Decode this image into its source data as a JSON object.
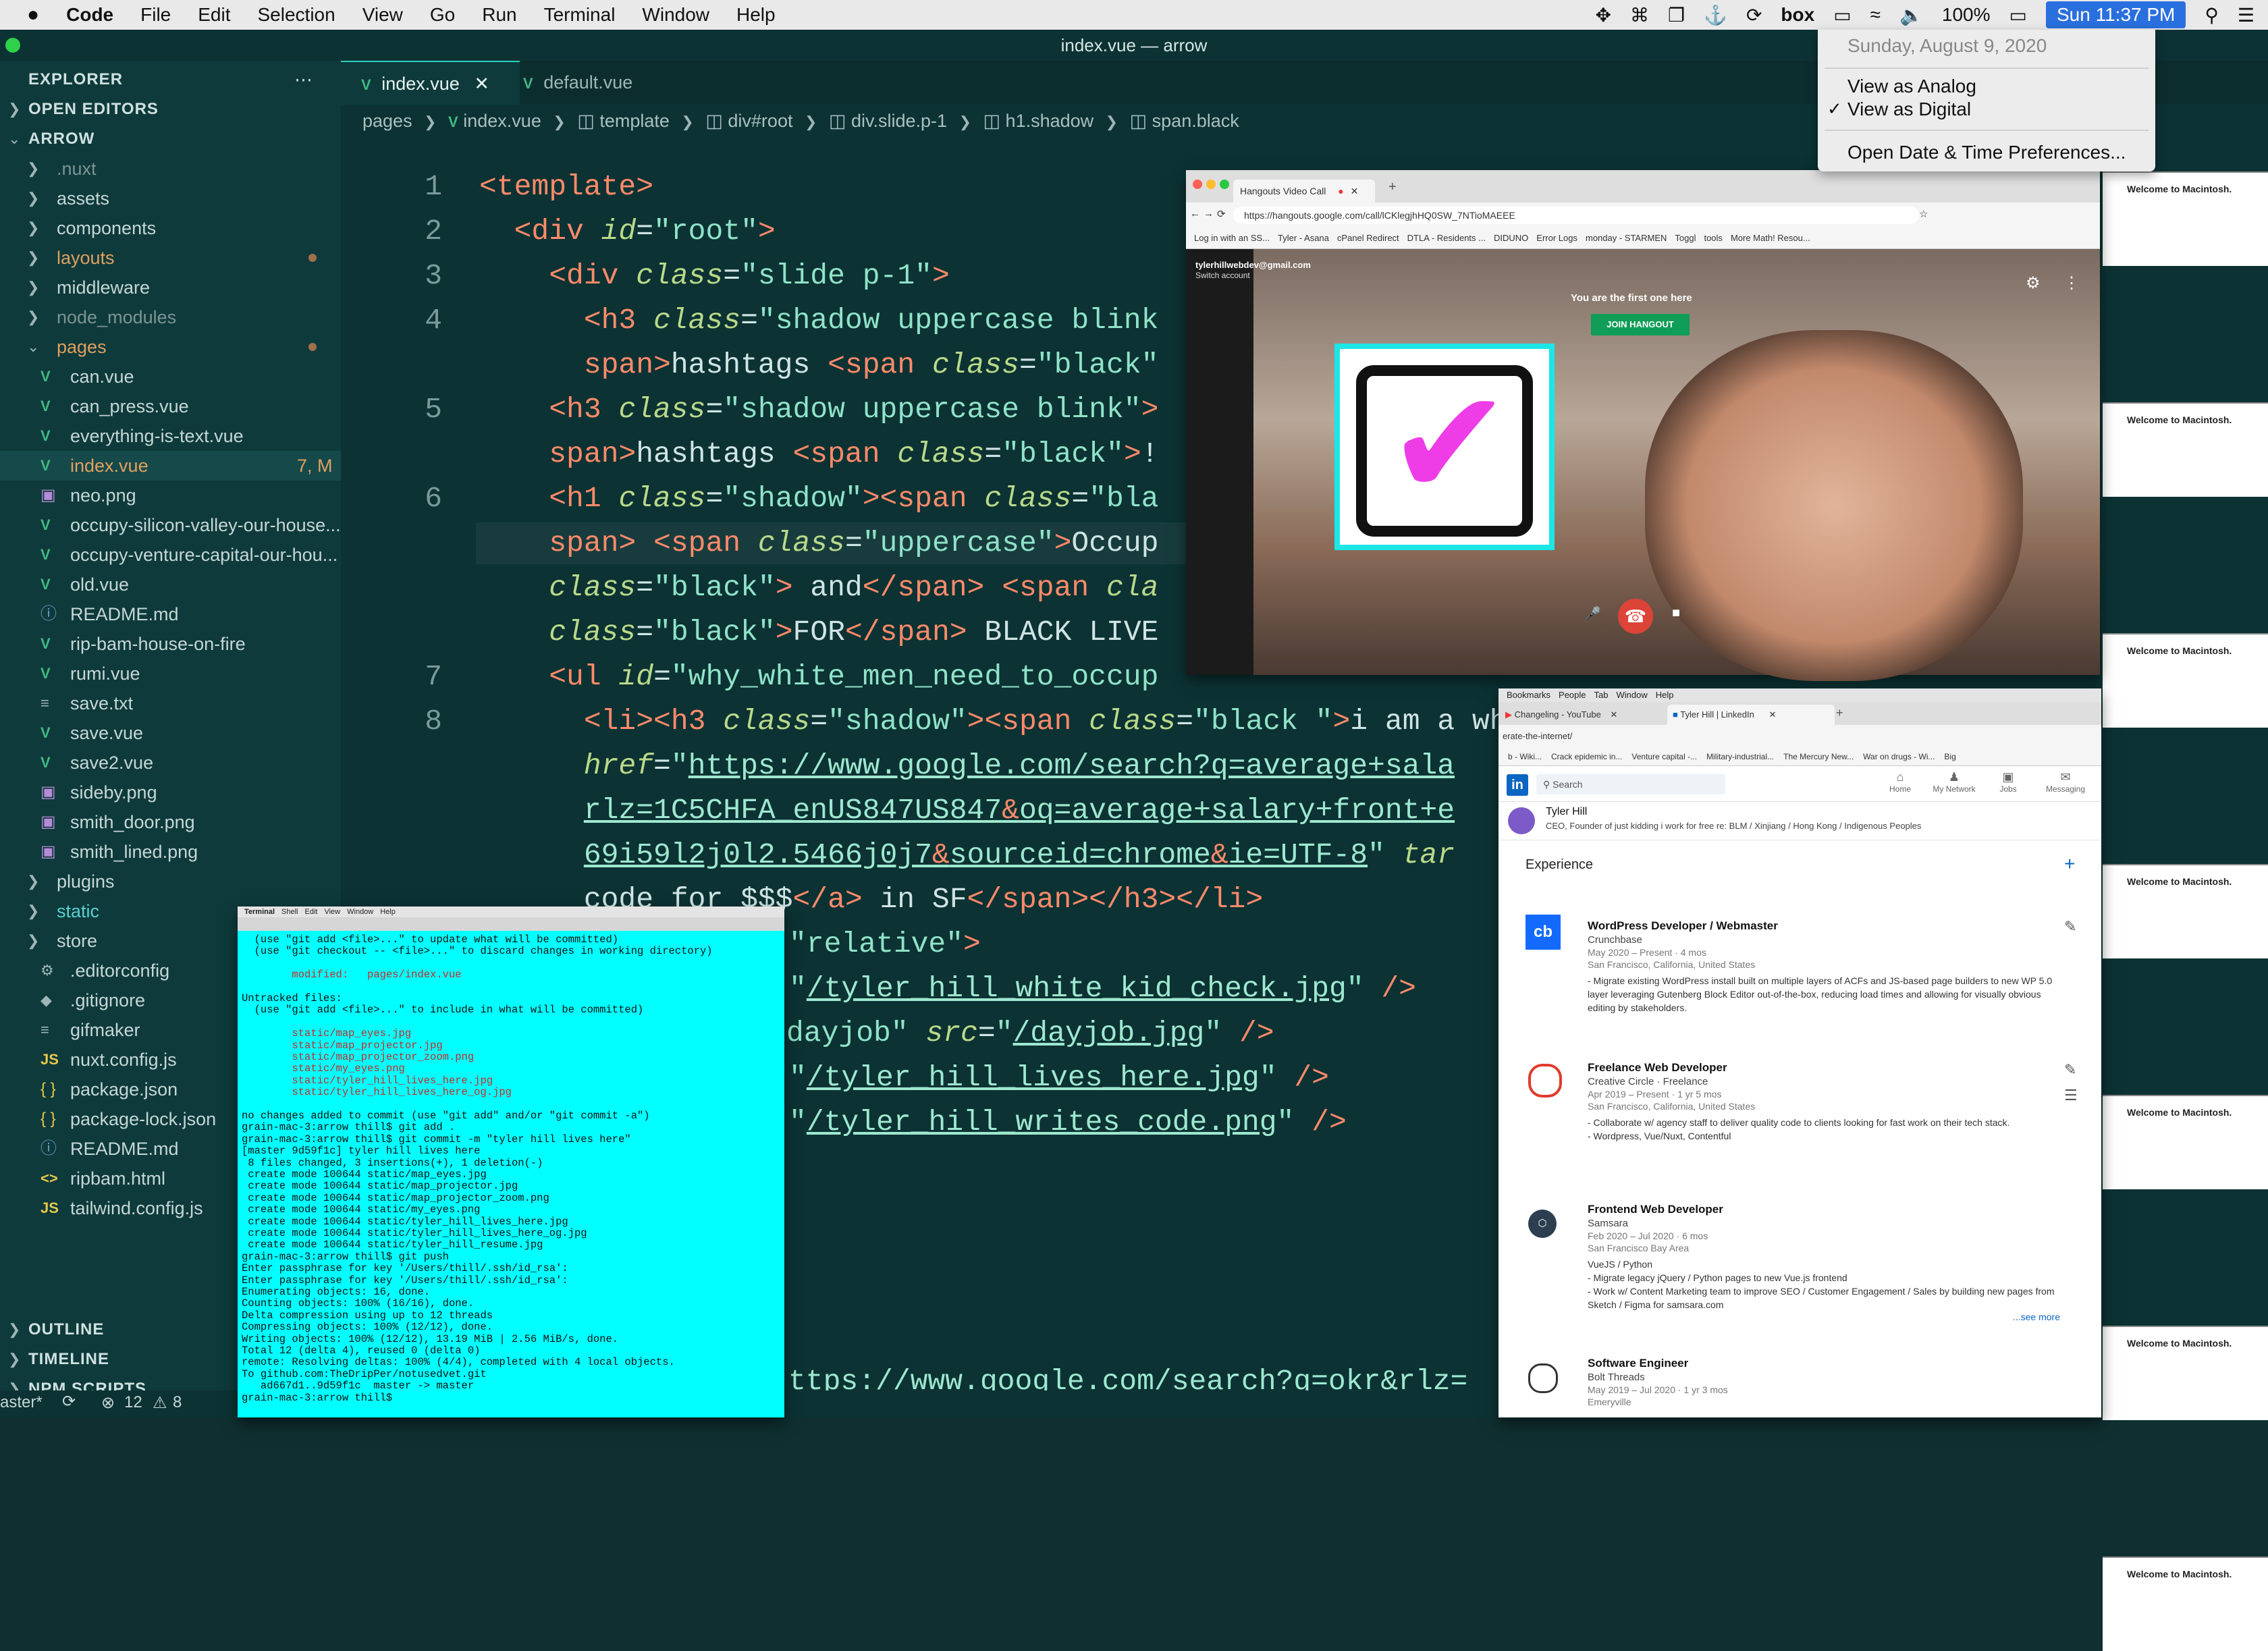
{
  "menubar": {
    "apple": "",
    "app": "Code",
    "items": [
      "File",
      "Edit",
      "Selection",
      "View",
      "Go",
      "Run",
      "Terminal",
      "Window",
      "Help"
    ],
    "battery": "100%",
    "clock": "Sun 11:37 PM",
    "box_label": "box"
  },
  "clock_menu": {
    "date": "Sunday, August 9, 2020",
    "analog": "View as Analog",
    "digital": "View as Digital",
    "prefs": "Open Date & Time Preferences..."
  },
  "window_title": "index.vue — arrow",
  "explorer": {
    "title": "EXPLORER",
    "open_editors": "OPEN EDITORS",
    "project": "ARROW",
    "tree": [
      {
        "name": ".nuxt",
        "type": "folder",
        "dim": true
      },
      {
        "name": "assets",
        "type": "folder"
      },
      {
        "name": "components",
        "type": "folder"
      },
      {
        "name": "layouts",
        "type": "folder",
        "modified": true
      },
      {
        "name": "middleware",
        "type": "folder"
      },
      {
        "name": "node_modules",
        "type": "folder",
        "dim": true
      },
      {
        "name": "pages",
        "type": "folder-open",
        "modified": true
      },
      {
        "name": "can.vue",
        "type": "vue"
      },
      {
        "name": "can_press.vue",
        "type": "vue"
      },
      {
        "name": "everything-is-text.vue",
        "type": "vue"
      },
      {
        "name": "index.vue",
        "type": "vue",
        "badge": "7, M"
      },
      {
        "name": "neo.png",
        "type": "img"
      },
      {
        "name": "occupy-silicon-valley-our-house...",
        "type": "vue"
      },
      {
        "name": "occupy-venture-capital-our-hou...",
        "type": "vue"
      },
      {
        "name": "old.vue",
        "type": "vue"
      },
      {
        "name": "README.md",
        "type": "info"
      },
      {
        "name": "rip-bam-house-on-fire",
        "type": "vue"
      },
      {
        "name": "rumi.vue",
        "type": "vue"
      },
      {
        "name": "save.txt",
        "type": "txt"
      },
      {
        "name": "save.vue",
        "type": "vue"
      },
      {
        "name": "save2.vue",
        "type": "vue"
      },
      {
        "name": "sideby.png",
        "type": "img"
      },
      {
        "name": "smith_door.png",
        "type": "img"
      },
      {
        "name": "smith_lined.png",
        "type": "img"
      },
      {
        "name": "plugins",
        "type": "folder"
      },
      {
        "name": "static",
        "type": "folder",
        "accent": true
      },
      {
        "name": "store",
        "type": "folder"
      },
      {
        "name": ".editorconfig",
        "type": "gear"
      },
      {
        "name": ".gitignore",
        "type": "diamond"
      },
      {
        "name": "gifmaker",
        "type": "txt"
      },
      {
        "name": "nuxt.config.js",
        "type": "js"
      },
      {
        "name": "package.json",
        "type": "brace"
      },
      {
        "name": "package-lock.json",
        "type": "brace"
      },
      {
        "name": "README.md",
        "type": "info"
      },
      {
        "name": "ripbam.html",
        "type": "html"
      },
      {
        "name": "tailwind.config.js",
        "type": "js"
      }
    ],
    "outline": "OUTLINE",
    "timeline": "TIMELINE",
    "npm": "NPM SCRIPTS"
  },
  "tabs": [
    {
      "label": "index.vue",
      "active": true
    },
    {
      "label": "default.vue",
      "active": false
    }
  ],
  "breadcrumb": [
    "pages",
    "index.vue",
    "template",
    "div#root",
    "div.slide.p-1",
    "h1.shadow",
    "span.black"
  ],
  "editor": {
    "line_numbers": [
      "1",
      "2",
      "3",
      "4",
      "5",
      "6",
      "7",
      "8"
    ],
    "bottom_url": "ttps://www.google.com/search?q=okr&rlz="
  },
  "status": {
    "branch": "aster*",
    "errors": "12",
    "warnings": "8"
  },
  "hangouts": {
    "tab": "Hangouts Video Call",
    "url": "https://hangouts.google.com/call/lCKlegjhHQ0SW_7NTioMAEEE",
    "bookmarks": [
      "Log in with an SS...",
      "Tyler - Asana",
      "cPanel Redirect",
      "DTLA - Residents ...",
      "DIDUNO",
      "Error Logs",
      "monday - STARMEN",
      "Toggl",
      "tools",
      "More Math! Resou..."
    ],
    "account": "tylerhillwebdev@gmail.com",
    "switch": "Switch account",
    "first": "You are the first one here",
    "join": "JOIN HANGOUT"
  },
  "linkedin": {
    "tabs": [
      "Changeling - YouTube",
      "Tyler Hill | LinkedIn"
    ],
    "menu": [
      "Bookmarks",
      "People",
      "Tab",
      "Window",
      "Help"
    ],
    "url": "erate-the-internet/",
    "bookmarks": [
      "b - Wiki...",
      "Crack epidemic in...",
      "Venture capital -...",
      "Military-industrial...",
      "The Mercury New...",
      "War on drugs - Wi...",
      "Big"
    ],
    "search": "Search",
    "nav": [
      "Home",
      "My Network",
      "Jobs",
      "Messaging"
    ],
    "name": "Tyler Hill",
    "headline": "CEO, Founder of just kidding i work for free re: BLM / Xinjiang / Hong Kong / Indigenous Peoples",
    "section": "Experience",
    "jobs": [
      {
        "title": "WordPress Developer / Webmaster",
        "company": "Crunchbase",
        "dates": "May 2020 – Present · 4 mos",
        "location": "San Francisco, California, United States",
        "desc": "- Migrate existing WordPress install built on multiple layers of ACFs and JS-based page builders to new WP 5.0 layer leveraging Gutenberg Block Editor out-of-the-box, reducing load times and allowing for visually obvious editing by stakeholders."
      },
      {
        "title": "Freelance Web Developer",
        "company": "Creative Circle · Freelance",
        "dates": "Apr 2019 – Present · 1 yr 5 mos",
        "location": "San Francisco, California, United States",
        "desc": "- Collaborate w/ agency staff to deliver quality code to clients looking for fast work on their tech stack.\n- Wordpress, Vue/Nuxt, Contentful"
      },
      {
        "title": "Frontend Web Developer",
        "company": "Samsara",
        "dates": "Feb 2020 – Jul 2020 · 6 mos",
        "location": "San Francisco Bay Area",
        "desc": "VueJS / Python\n- Migrate legacy jQuery / Python pages to new Vue.js frontend\n- Work w/ Content Marketing team to improve SEO / Customer Engagement / Sales by building new pages from Sketch / Figma for samsara.com",
        "more": "...see more"
      },
      {
        "title": "Software Engineer",
        "company": "Bolt Threads",
        "dates": "May 2019 – Jul 2020 · 1 yr 3 mos",
        "location": "Emeryville",
        "desc": ""
      }
    ]
  },
  "terminal": {
    "menu": [
      "Terminal",
      "Shell",
      "Edit",
      "View",
      "Window",
      "Help"
    ],
    "lines": [
      {
        "t": "  (use \"git add <file>...\" to update what will be committed)"
      },
      {
        "t": "  (use \"git checkout -- <file>...\" to discard changes in working directory)"
      },
      {
        "t": ""
      },
      {
        "t": "        modified:   pages/index.vue",
        "red": true
      },
      {
        "t": ""
      },
      {
        "t": "Untracked files:"
      },
      {
        "t": "  (use \"git add <file>...\" to include in what will be committed)"
      },
      {
        "t": ""
      },
      {
        "t": "        static/map_eyes.jpg",
        "red": true
      },
      {
        "t": "        static/map_projector.jpg",
        "red": true
      },
      {
        "t": "        static/map_projector_zoom.png",
        "red": true
      },
      {
        "t": "        static/my_eyes.png",
        "red": true
      },
      {
        "t": "        static/tyler_hill_lives_here.jpg",
        "red": true
      },
      {
        "t": "        static/tyler_hill_lives_here_og.jpg",
        "red": true
      },
      {
        "t": ""
      },
      {
        "t": "no changes added to commit (use \"git add\" and/or \"git commit -a\")"
      },
      {
        "t": "grain-mac-3:arrow thill$ git add ."
      },
      {
        "t": "grain-mac-3:arrow thill$ git commit -m \"tyler hill lives here\""
      },
      {
        "t": "[master 9d59f1c] tyler hill lives here"
      },
      {
        "t": " 8 files changed, 3 insertions(+), 1 deletion(-)"
      },
      {
        "t": " create mode 100644 static/map_eyes.jpg"
      },
      {
        "t": " create mode 100644 static/map_projector.jpg"
      },
      {
        "t": " create mode 100644 static/map_projector_zoom.png"
      },
      {
        "t": " create mode 100644 static/my_eyes.png"
      },
      {
        "t": " create mode 100644 static/tyler_hill_lives_here.jpg"
      },
      {
        "t": " create mode 100644 static/tyler_hill_lives_here_og.jpg"
      },
      {
        "t": " create mode 100644 static/tyler_hill_resume.jpg"
      },
      {
        "t": "grain-mac-3:arrow thill$ git push"
      },
      {
        "t": "Enter passphrase for key '/Users/thill/.ssh/id_rsa':"
      },
      {
        "t": "Enter passphrase for key '/Users/thill/.ssh/id_rsa':"
      },
      {
        "t": "Enumerating objects: 16, done."
      },
      {
        "t": "Counting objects: 100% (16/16), done."
      },
      {
        "t": "Delta compression using up to 12 threads"
      },
      {
        "t": "Compressing objects: 100% (12/12), done."
      },
      {
        "t": "Writing objects: 100% (12/12), 13.19 MiB | 2.56 MiB/s, done."
      },
      {
        "t": "Total 12 (delta 4), reused 0 (delta 0)"
      },
      {
        "t": "remote: Resolving deltas: 100% (4/4), completed with 4 local objects."
      },
      {
        "t": "To github.com:TheDripPer/notusedvet.git"
      },
      {
        "t": "   ad667d1..9d59f1c  master -> master"
      },
      {
        "t": "grain-mac-3:arrow thill$ "
      }
    ]
  },
  "thumbnails": [
    "Welcome to Macintosh.",
    "Welcome to Macintosh.",
    "Welcome to Macintosh.",
    "Welcome to Macintosh.",
    "Welcome to Macintosh.",
    "Welcome to Macintosh.",
    "Welcome to Macintosh."
  ]
}
